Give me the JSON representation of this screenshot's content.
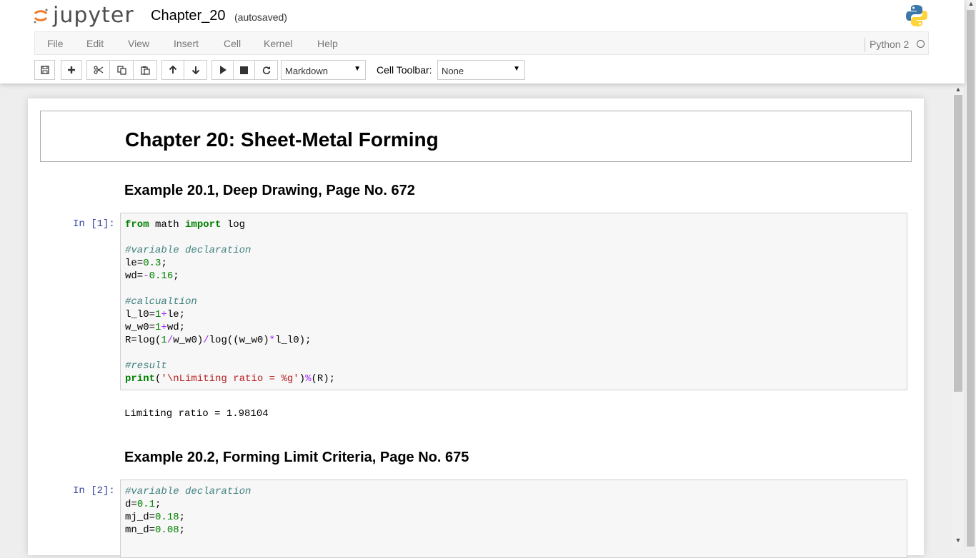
{
  "header": {
    "logo_text": "jupyter",
    "notebook_name": "Chapter_20",
    "save_status": "(autosaved)"
  },
  "menu": {
    "file": "File",
    "edit": "Edit",
    "view": "View",
    "insert": "Insert",
    "cell": "Cell",
    "kernel": "Kernel",
    "help": "Help"
  },
  "kernel": {
    "name": "Python 2",
    "status": "idle"
  },
  "toolbar": {
    "cell_type": "Markdown",
    "cell_toolbar_label": "Cell Toolbar:",
    "cell_toolbar_value": "None"
  },
  "cells": {
    "title": "Chapter 20: Sheet-Metal Forming",
    "example1_heading": "Example 20.1, Deep Drawing, Page No. 672",
    "example1_prompt": "In [1]:",
    "example1_output": "Limiting ratio = 1.98104",
    "example2_heading": "Example 20.2, Forming Limit Criteria, Page No. 675",
    "example2_prompt": "In [2]:",
    "code1": {
      "line1_kw1": "from",
      "line1_mod": " math ",
      "line1_kw2": "import",
      "line1_name": " log",
      "comment1": "#variable declaration",
      "le_name": "le=",
      "le_val": "0.3",
      "wd_name": "wd=",
      "wd_op": "-",
      "wd_val": "0.16",
      "comment2": "#calcualtion",
      "l_l0_name": "l_l0=",
      "w_w0_name": "w_w0=",
      "one": "1",
      "plus": "+",
      "le_ref": "le;",
      "wd_ref": "wd;",
      "r_part1": "R=log(",
      "slash": "/",
      "r_part2": "w_w0)",
      "r_part3": "log((w_w0)",
      "star": "*",
      "r_part4": "l_l0);",
      "comment3": "#result",
      "print_kw": "print",
      "print_open": "(",
      "print_str": "'\\nLimiting ratio = %g'",
      "print_close": ")",
      "percent": "%",
      "print_tail": "(R);",
      "semicolon": ";"
    },
    "code2": {
      "comment1": "#variable declaration",
      "d_name": "d=",
      "d_val": "0.1",
      "mj_name": "mj_d=",
      "mj_val": "0.18",
      "mn_name": "mn_d=",
      "mn_val": "0.08",
      "semicolon": ";"
    }
  },
  "colors": {
    "prompt": "#303f9f",
    "keyword": "#008000",
    "comment": "#408080",
    "string": "#ba2121",
    "operator": "#aa22ff"
  }
}
